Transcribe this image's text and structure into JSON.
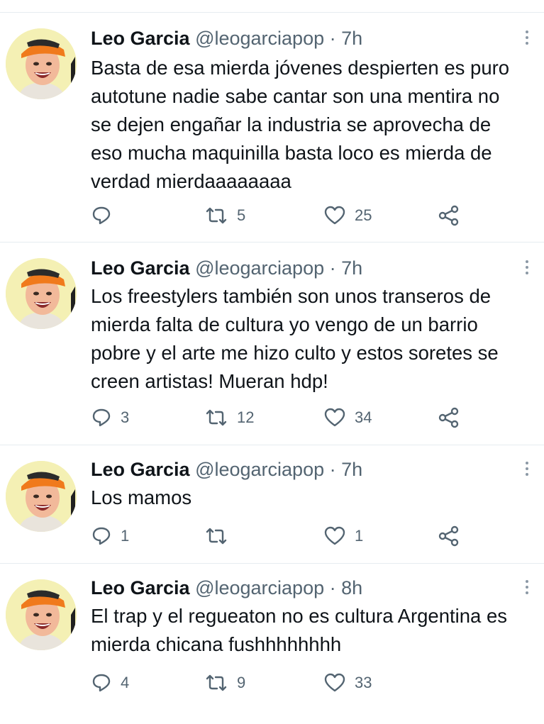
{
  "colors": {
    "text": "#0f1419",
    "secondary": "#536471",
    "icon": "#536471",
    "divider": "#e6ecf0"
  },
  "tweets": [
    {
      "name": "Leo Garcia",
      "handle": "@leogarciapop",
      "separator": "·",
      "time": "7h",
      "text": "Basta de esa mierda jóvenes despierten es puro\nautotune nadie sabe cantar son una mentira no\nse dejen engañar la industria se aprovecha de\neso mucha maquinilla basta loco es mierda de\nverdad mierdaaaaaaaa",
      "replies": "",
      "retweets": "5",
      "likes": "25"
    },
    {
      "name": "Leo Garcia",
      "handle": "@leogarciapop",
      "separator": "·",
      "time": "7h",
      "text": "Los freestylers también son unos transeros de\nmierda falta de cultura yo vengo de un barrio\npobre y el arte me hizo culto y estos soretes se\ncreen artistas! Mueran hdp!",
      "replies": "3",
      "retweets": "12",
      "likes": "34"
    },
    {
      "name": "Leo Garcia",
      "handle": "@leogarciapop",
      "separator": "·",
      "time": "7h",
      "text": "Los mamos",
      "replies": "1",
      "retweets": "",
      "likes": "1"
    },
    {
      "name": "Leo Garcia",
      "handle": "@leogarciapop",
      "separator": "·",
      "time": "8h",
      "text": "El trap y el regueaton no es cultura Argentina es\nmierda chicana fushhhhhhhh",
      "replies": "4",
      "retweets": "9",
      "likes": "33"
    }
  ]
}
